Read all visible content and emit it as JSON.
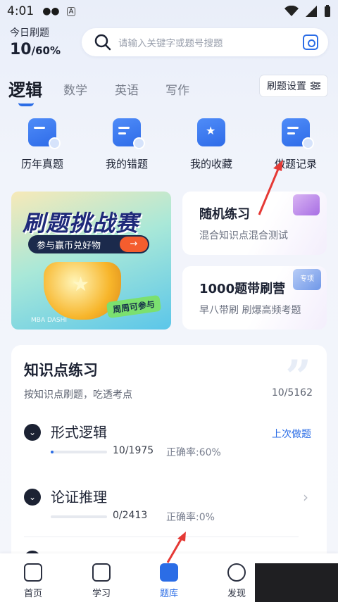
{
  "status_bar": {
    "time": "4:01",
    "icons": [
      "wechat-icon",
      "a-icon"
    ],
    "right_icons": [
      "wifi-icon",
      "signal-icon",
      "battery-icon"
    ]
  },
  "header": {
    "today_label": "今日刷题",
    "today_value": "10",
    "today_percent": "/60%",
    "search_placeholder": "请输入关键字或题号搜题"
  },
  "tabs": {
    "items": [
      "逻辑",
      "数学",
      "英语",
      "写作"
    ],
    "active": "逻辑",
    "settings_label": "刷题设置"
  },
  "quick_actions": [
    {
      "label": "历年真题",
      "icon": "calendar-folder-icon"
    },
    {
      "label": "我的错题",
      "icon": "wrong-questions-icon"
    },
    {
      "label": "我的收藏",
      "icon": "star-bookmark-icon"
    },
    {
      "label": "做题记录",
      "icon": "record-edit-icon"
    }
  ],
  "banner": {
    "title": "刷题挑战赛",
    "pill": "参与赢币兑好物",
    "tag": "周周可参与",
    "brand": "MBA DASHI"
  },
  "cards": [
    {
      "title": "随机练习",
      "subtitle": "混合知识点混合测试"
    },
    {
      "title": "1000题带刷营",
      "subtitle": "早八带刷  刷爆高频考题",
      "badge": "专项"
    }
  ],
  "knowledge": {
    "title": "知识点练习",
    "subtitle": "按知识点刷题，吃透考点",
    "count": "10/5162",
    "topics": [
      {
        "name": "形式逻辑",
        "count": "10/1975",
        "accuracy": "正确率:60%",
        "action": "上次做题",
        "progress": 0.05
      },
      {
        "name": "论证推理",
        "count": "0/2413",
        "accuracy": "正确率:0%",
        "progress": 0
      }
    ]
  },
  "tabbar": {
    "items": [
      {
        "label": "首页",
        "icon": "graduation-cap-icon"
      },
      {
        "label": "学习",
        "icon": "book-icon"
      },
      {
        "label": "题库",
        "icon": "question-bank-icon"
      },
      {
        "label": "发现",
        "icon": "compass-icon"
      }
    ],
    "active": "题库"
  },
  "colors": {
    "accent": "#2b6de6",
    "annotation_red": "#e53935"
  }
}
